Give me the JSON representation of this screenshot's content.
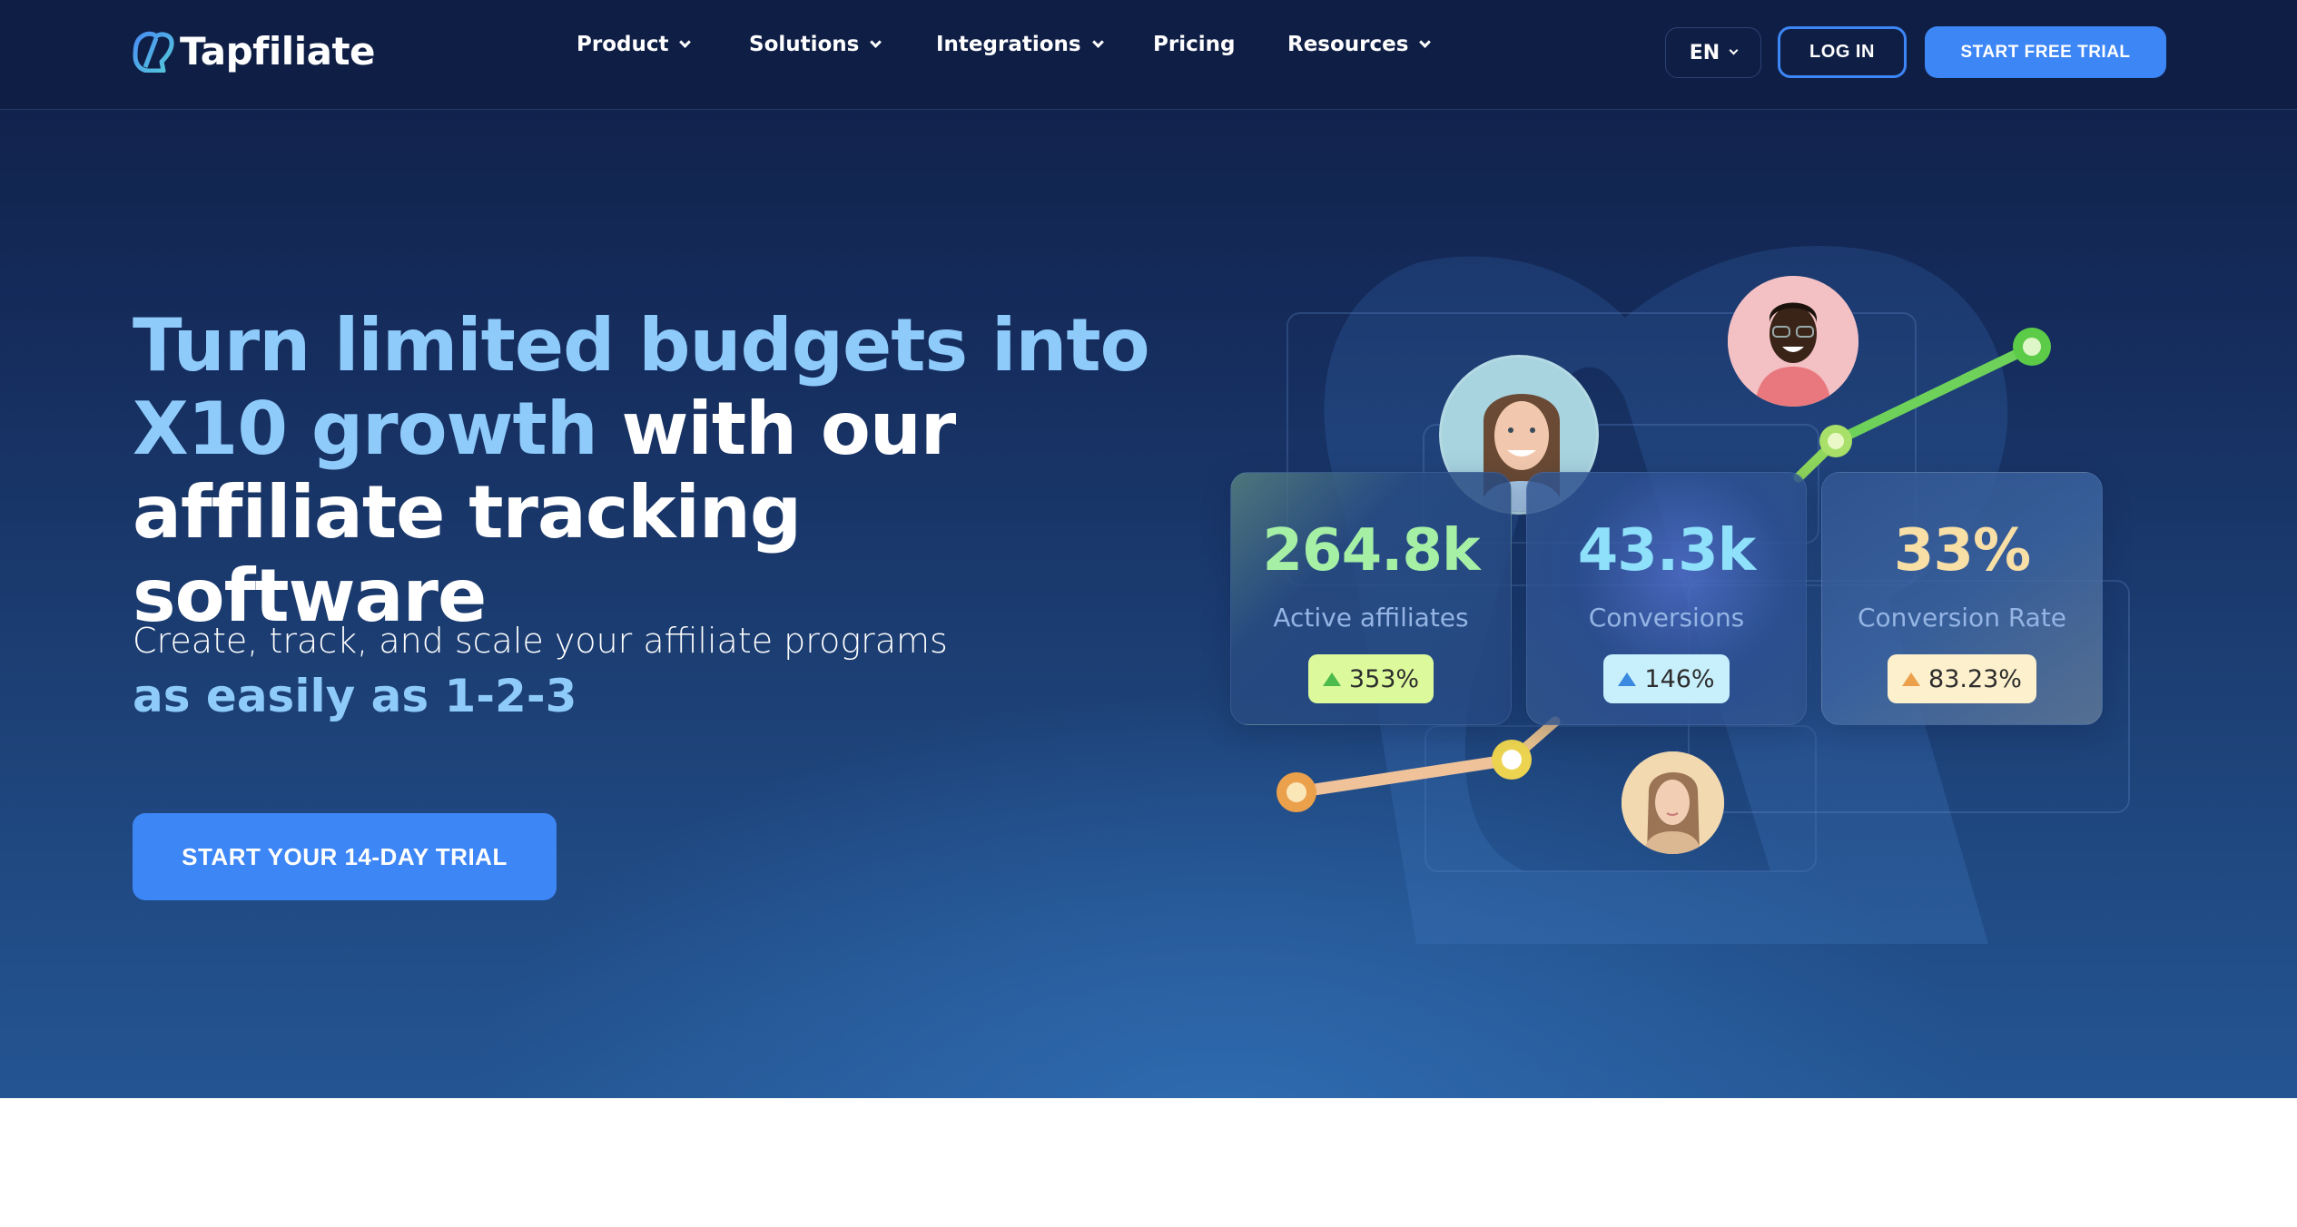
{
  "header": {
    "logo_text": "Tapfiliate",
    "nav": [
      {
        "label": "Product",
        "has_dropdown": true
      },
      {
        "label": "Solutions",
        "has_dropdown": true
      },
      {
        "label": "Integrations",
        "has_dropdown": true
      },
      {
        "label": "Pricing",
        "has_dropdown": false
      },
      {
        "label": "Resources",
        "has_dropdown": true
      }
    ],
    "language": "EN",
    "login_label": "LOG IN",
    "trial_label": "START FREE TRIAL"
  },
  "hero": {
    "headline_accent_1": "Turn limited budgets into",
    "headline_accent_2": "X10 growth",
    "headline_rest_1": " with our",
    "headline_rest_2": "affiliate tracking software",
    "subtitle": "Create, track, and scale your affiliate programs",
    "subtitle_accent": "as easily as 1-2-3",
    "cta_label": "START YOUR 14-DAY TRIAL"
  },
  "stats": [
    {
      "value": "264.8k",
      "label": "Active affiliates",
      "change": "353%",
      "trend": "up",
      "value_color": "#a6f0a6",
      "badge_bg": "#dcfa9c",
      "arrow_color": "#4cbb4c"
    },
    {
      "value": "43.3k",
      "label": "Conversions",
      "change": "146%",
      "trend": "up",
      "value_color": "#8ee0fb",
      "badge_bg": "#c8f0fc",
      "arrow_color": "#3a88e0"
    },
    {
      "value": "33%",
      "label": "Conversion Rate",
      "change": "83.23%",
      "trend": "up",
      "value_color": "#f8dfa6",
      "badge_bg": "#fdf0cc",
      "arrow_color": "#eba04c"
    }
  ],
  "colors": {
    "accent": "#3d86f5",
    "headline_accent": "#8ecbfb",
    "nav_bg": "#0f1e45"
  },
  "avatars": [
    {
      "name": "avatar-woman-smiling",
      "bg": "#a8d4e0"
    },
    {
      "name": "avatar-man-glasses",
      "bg": "#f3c0c4"
    },
    {
      "name": "avatar-woman-beige",
      "bg": "#f2d9b0"
    }
  ]
}
